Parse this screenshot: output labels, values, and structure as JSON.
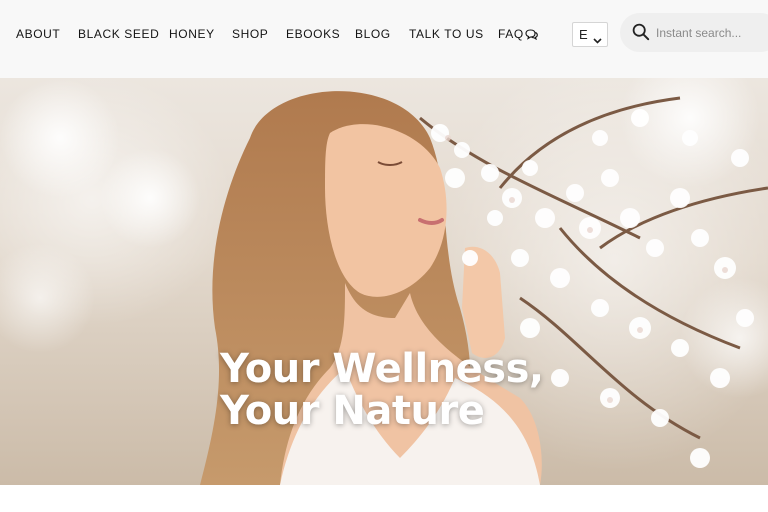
{
  "nav": {
    "items": [
      {
        "label": "ABOUT"
      },
      {
        "label": "BLACK SEED"
      },
      {
        "label": "HONEY"
      },
      {
        "label": "SHOP"
      },
      {
        "label": "EBOOKS"
      },
      {
        "label": "BLOG"
      },
      {
        "label": "TALK TO US"
      },
      {
        "label": "FAQ",
        "icon": "chat-bubbles-icon"
      }
    ]
  },
  "language": {
    "selected": "E",
    "icon": "chevron-down-icon"
  },
  "search": {
    "placeholder": "Instant search...",
    "value": "",
    "icon": "search-icon"
  },
  "hero": {
    "title_line1": "Your Wellness,",
    "title_line2": "Your Nature",
    "image": "woman-smelling-blossoms-photo"
  },
  "colors": {
    "header_bg": "#f8f8f8",
    "nav_text": "#141414",
    "search_bg": "#efefef",
    "hero_title": "#ffffff"
  }
}
